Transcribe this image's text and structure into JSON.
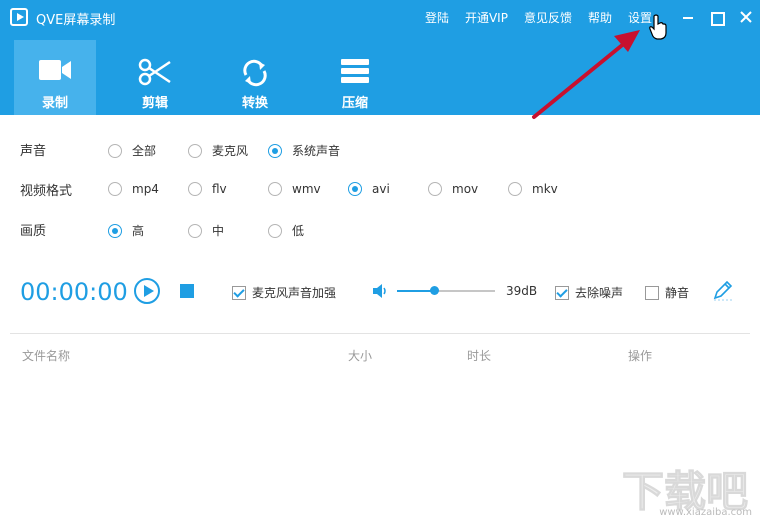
{
  "window": {
    "title": "QVE屏幕录制",
    "links": [
      "登陆",
      "开通VIP",
      "意见反馈",
      "帮助",
      "设置"
    ]
  },
  "tabs": [
    {
      "label": "录制",
      "icon": "video-camera-icon",
      "active": true
    },
    {
      "label": "剪辑",
      "icon": "scissors-icon",
      "active": false
    },
    {
      "label": "转换",
      "icon": "convert-arrows-icon",
      "active": false
    },
    {
      "label": "压缩",
      "icon": "compress-icon",
      "active": false
    }
  ],
  "options": {
    "sound": {
      "label": "声音",
      "choices": [
        "全部",
        "麦克风",
        "系统声音"
      ],
      "selected": "系统声音"
    },
    "format": {
      "label": "视频格式",
      "choices": [
        "mp4",
        "flv",
        "wmv",
        "avi",
        "mov",
        "mkv"
      ],
      "selected": "avi"
    },
    "quality": {
      "label": "画质",
      "choices": [
        "高",
        "中",
        "低"
      ],
      "selected": "高"
    }
  },
  "controls": {
    "timer": "00:00:00",
    "mic_boost_label": "麦克风声音加强",
    "mic_boost_checked": true,
    "volume_db": "39dB",
    "volume_fraction": 0.38,
    "denoise_label": "去除噪声",
    "denoise_checked": true,
    "mute_label": "静音",
    "mute_checked": false
  },
  "file_table": {
    "columns": [
      "文件名称",
      "大小",
      "时长",
      "操作"
    ]
  },
  "colors": {
    "accent": "#1f9ee3",
    "tab_active": "#46b2ec",
    "arrow": "#c8102e"
  },
  "watermark": {
    "brand": "下载吧",
    "url": "www.xiazaiba.com"
  }
}
